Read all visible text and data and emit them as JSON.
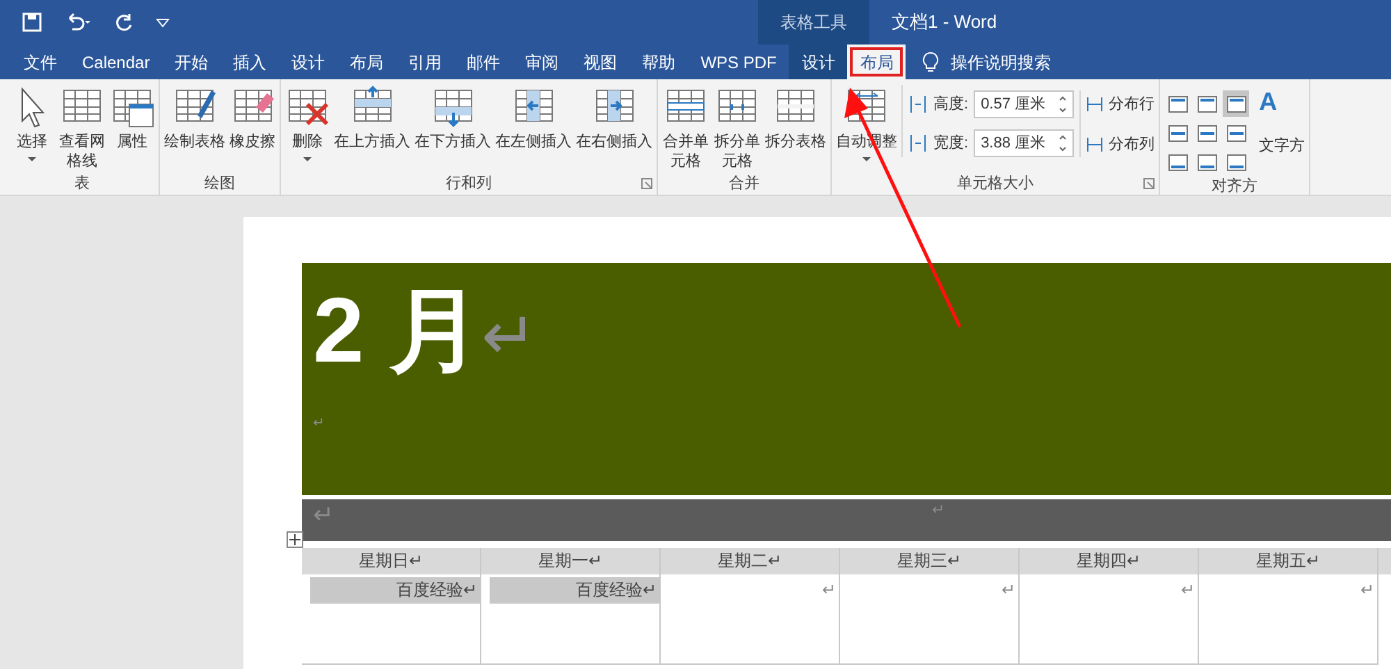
{
  "title_bar": {
    "context_label": "表格工具",
    "title": "文档1 - Word"
  },
  "menu_tabs": [
    {
      "label": "文件",
      "kind": "normal",
      "selected": false
    },
    {
      "label": "Calendar",
      "kind": "normal",
      "selected": false
    },
    {
      "label": "开始",
      "kind": "normal",
      "selected": false
    },
    {
      "label": "插入",
      "kind": "normal",
      "selected": false
    },
    {
      "label": "设计",
      "kind": "normal",
      "selected": false
    },
    {
      "label": "布局",
      "kind": "normal",
      "selected": false
    },
    {
      "label": "引用",
      "kind": "normal",
      "selected": false
    },
    {
      "label": "邮件",
      "kind": "normal",
      "selected": false
    },
    {
      "label": "审阅",
      "kind": "normal",
      "selected": false
    },
    {
      "label": "视图",
      "kind": "normal",
      "selected": false
    },
    {
      "label": "帮助",
      "kind": "normal",
      "selected": false
    },
    {
      "label": "WPS PDF",
      "kind": "normal",
      "selected": false
    },
    {
      "label": "设计",
      "kind": "context",
      "selected": false
    },
    {
      "label": "布局",
      "kind": "context",
      "selected": true
    }
  ],
  "search": {
    "label": "操作说明搜索"
  },
  "ribbon": [
    {
      "label": "表",
      "launcher": false,
      "items": [
        {
          "kind": "button",
          "label": "选择",
          "dropdown": true
        },
        {
          "kind": "button",
          "label": "查看网格线",
          "dropdown": false
        },
        {
          "kind": "button",
          "label": "属性",
          "dropdown": false
        }
      ]
    },
    {
      "label": "绘图",
      "launcher": false,
      "items": [
        {
          "kind": "button",
          "label": "绘制表格",
          "dropdown": false
        },
        {
          "kind": "button",
          "label": "橡皮擦",
          "dropdown": false
        }
      ]
    },
    {
      "label": "行和列",
      "launcher": true,
      "items": [
        {
          "kind": "button",
          "label": "删除",
          "dropdown": true
        },
        {
          "kind": "button",
          "label": "在上方插入",
          "dropdown": false
        },
        {
          "kind": "button",
          "label": "在下方插入",
          "dropdown": false
        },
        {
          "kind": "button",
          "label": "在左侧插入",
          "dropdown": false
        },
        {
          "kind": "button",
          "label": "在右侧插入",
          "dropdown": false
        }
      ]
    },
    {
      "label": "合并",
      "launcher": false,
      "items": [
        {
          "kind": "button",
          "label": "合并单元格",
          "dropdown": false
        },
        {
          "kind": "button",
          "label": "拆分单元格",
          "dropdown": false
        },
        {
          "kind": "button",
          "label": "拆分表格",
          "dropdown": false
        }
      ]
    },
    {
      "label": "单元格大小",
      "launcher": true,
      "items": [
        {
          "kind": "button",
          "label": "自动调整",
          "dropdown": true
        },
        {
          "kind": "sizes",
          "fields": [
            {
              "label": "高度:",
              "value": "0.57 厘米"
            },
            {
              "label": "宽度:",
              "value": "3.88 厘米"
            }
          ],
          "actions": [
            "分布行",
            "分布列"
          ]
        }
      ]
    },
    {
      "label": "对齐方",
      "launcher": false,
      "items": [
        {
          "kind": "align",
          "cells": [
            {
              "selected": false
            },
            {
              "selected": false
            },
            {
              "selected": true
            },
            {
              "selected": false
            },
            {
              "selected": false
            },
            {
              "selected": false
            },
            {
              "selected": false
            },
            {
              "selected": false
            },
            {
              "selected": false
            }
          ]
        },
        {
          "kind": "textdir",
          "glyph": "A",
          "label": "文字方"
        }
      ]
    }
  ],
  "document": {
    "heading": "2 月",
    "heading_mark": "↵",
    "mark": "↵",
    "band_marks": [
      "↵",
      "↵"
    ],
    "table": {
      "header": [
        "星期日↵",
        "星期一↵",
        "星期二↵",
        "星期三↵",
        "星期四↵",
        "星期五↵"
      ],
      "rows": [
        [
          {
            "text": "百度经验↵",
            "shaded": true
          },
          {
            "text": "百度经验↵",
            "shaded": true
          },
          {
            "text": "↵",
            "shaded": false
          },
          {
            "text": "↵",
            "shaded": false
          },
          {
            "text": "↵",
            "shaded": false
          },
          {
            "text": "↵",
            "shaded": false
          }
        ]
      ]
    }
  },
  "annotation": {
    "highlight_tab": true,
    "arrow": true
  }
}
